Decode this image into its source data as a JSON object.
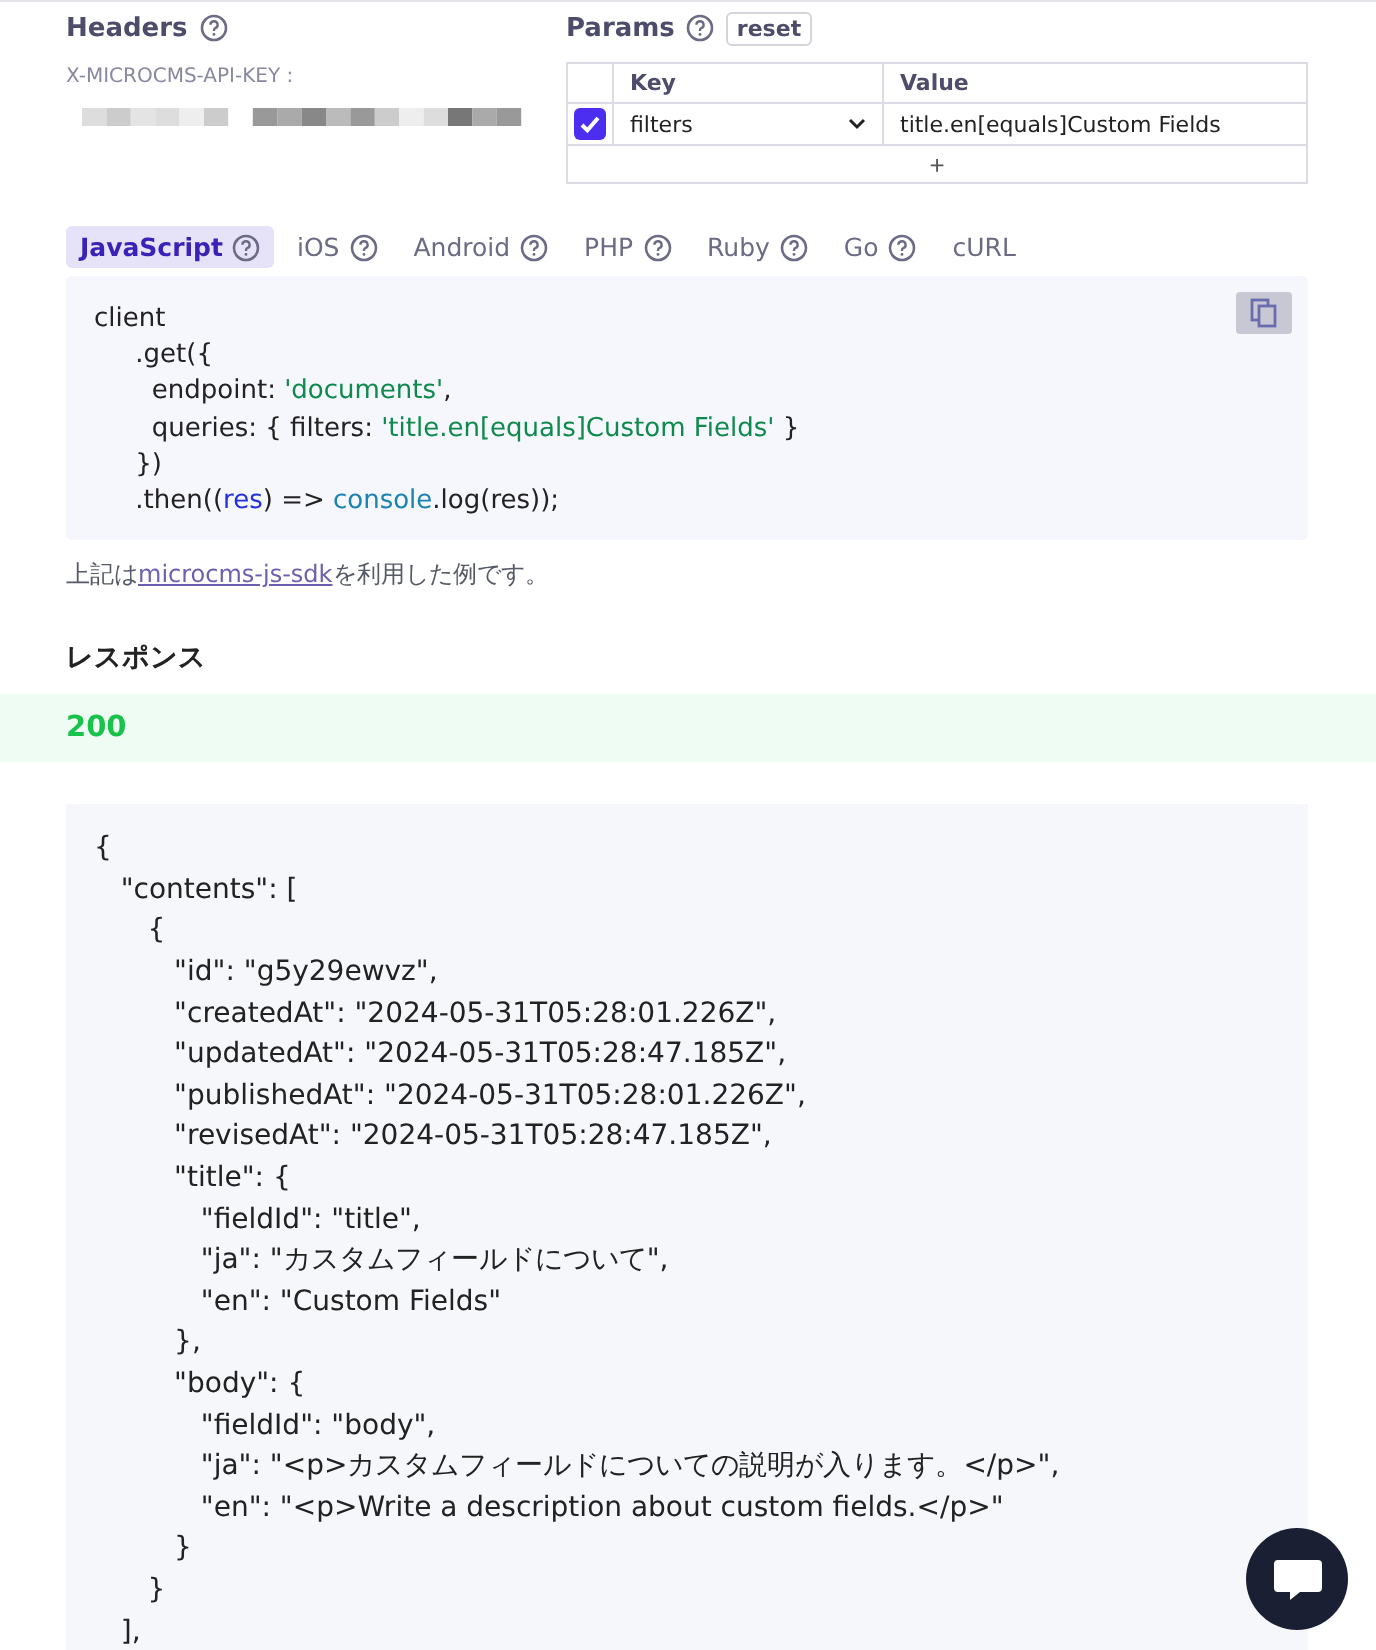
{
  "headers": {
    "title": "Headers",
    "key_label": "X-MICROCMS-API-KEY :"
  },
  "params": {
    "title": "Params",
    "reset": "reset",
    "columns": [
      "Key",
      "Value"
    ],
    "rows": [
      {
        "checked": true,
        "key": "filters",
        "value": "title.en[equals]Custom Fields"
      }
    ],
    "add": "+"
  },
  "tabs": [
    {
      "label": "JavaScript",
      "help": true,
      "selected": true
    },
    {
      "label": "iOS",
      "help": true,
      "selected": false
    },
    {
      "label": "Android",
      "help": true,
      "selected": false
    },
    {
      "label": "PHP",
      "help": true,
      "selected": false
    },
    {
      "label": "Ruby",
      "help": true,
      "selected": false
    },
    {
      "label": "Go",
      "help": true,
      "selected": false
    },
    {
      "label": "cURL",
      "help": false,
      "selected": false
    }
  ],
  "code": [
    [
      {
        "text": "client",
        "kind": "plain"
      }
    ],
    [
      {
        "text": "     .get({",
        "kind": "plain"
      }
    ],
    [
      {
        "text": "       endpoint: ",
        "kind": "plain"
      },
      {
        "text": "'documents'",
        "kind": "string"
      },
      {
        "text": ",",
        "kind": "plain"
      }
    ],
    [
      {
        "text": "       queries: { filters: ",
        "kind": "plain"
      },
      {
        "text": "'title.en[equals]Custom Fields'",
        "kind": "string"
      },
      {
        "text": " }",
        "kind": "plain"
      }
    ],
    [
      {
        "text": "     })",
        "kind": "plain"
      }
    ],
    [
      {
        "text": "     .then((",
        "kind": "plain"
      },
      {
        "text": "res",
        "kind": "param"
      },
      {
        "text": ") => ",
        "kind": "plain"
      },
      {
        "text": "console",
        "kind": "builtin"
      },
      {
        "text": ".log(res));",
        "kind": "plain"
      }
    ]
  ],
  "note": {
    "before": "上記は",
    "link": "microcms-js-sdk",
    "after": "を利用した例です。"
  },
  "response": {
    "title": "レスポンス",
    "status": "200",
    "lines": [
      "{",
      "   \"contents\": [",
      "      {",
      "         \"id\": \"g5y29ewvz\",",
      "         \"createdAt\": \"2024-05-31T05:28:01.226Z\",",
      "         \"updatedAt\": \"2024-05-31T05:28:47.185Z\",",
      "         \"publishedAt\": \"2024-05-31T05:28:01.226Z\",",
      "         \"revisedAt\": \"2024-05-31T05:28:47.185Z\",",
      "         \"title\": {",
      "            \"fieldId\": \"title\",",
      "            \"ja\": \"カスタムフィールドについて\",",
      "            \"en\": \"Custom Fields\"",
      "         },",
      "         \"body\": {",
      "            \"fieldId\": \"body\",",
      "            \"ja\": \"<p>カスタムフィールドについての説明が入ります。</p>\",",
      "            \"en\": \"<p>Write a description about custom fields.</p>\"",
      "         }",
      "      }",
      "   ],"
    ]
  }
}
